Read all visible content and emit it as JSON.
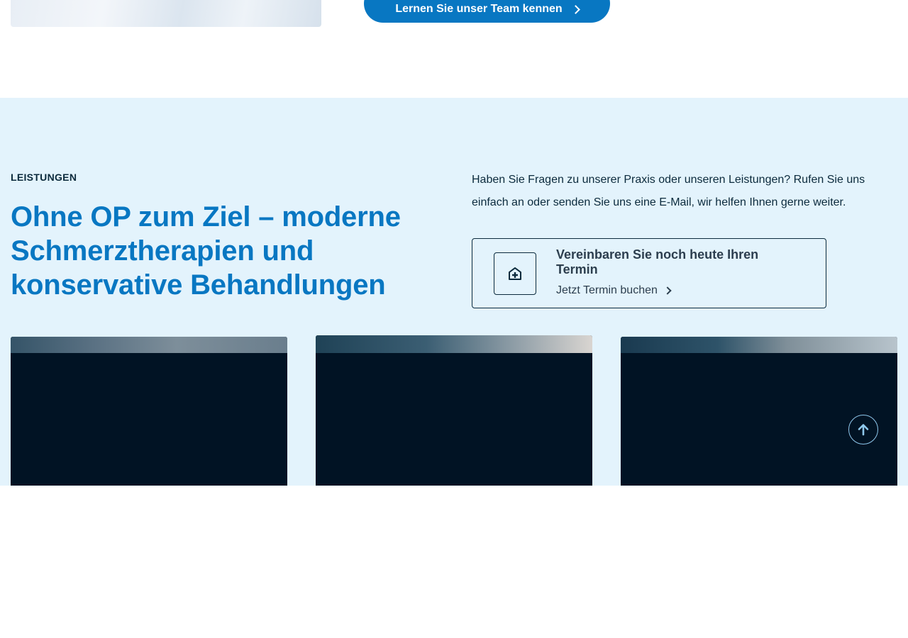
{
  "hero": {
    "team_button_label": "Lernen Sie unser Team kennen"
  },
  "services": {
    "eyebrow": "LEISTUNGEN",
    "headline": "Ohne OP zum Ziel – moderne Schmerztherapien und konservative Behandlungen",
    "intro": "Haben Sie Fragen zu unserer Praxis oder unseren Leistungen? Rufen Sie uns einfach an oder senden Sie uns eine E-Mail, wir helfen Ihnen gerne weiter.",
    "cta": {
      "title": "Vereinbaren Sie noch heute Ihren Termin",
      "link_label": "Jetzt Termin buchen",
      "icon": "hospital-house-icon"
    }
  },
  "icons": {
    "team_button": "chevron-right-icon",
    "cta_link": "chevron-right-icon",
    "scroll_top": "arrow-up-icon"
  },
  "colors": {
    "brand_blue": "#0877c2",
    "section_bg": "#e3f3fc",
    "dark_text": "#0b2a3c",
    "card_bg": "#011324"
  }
}
